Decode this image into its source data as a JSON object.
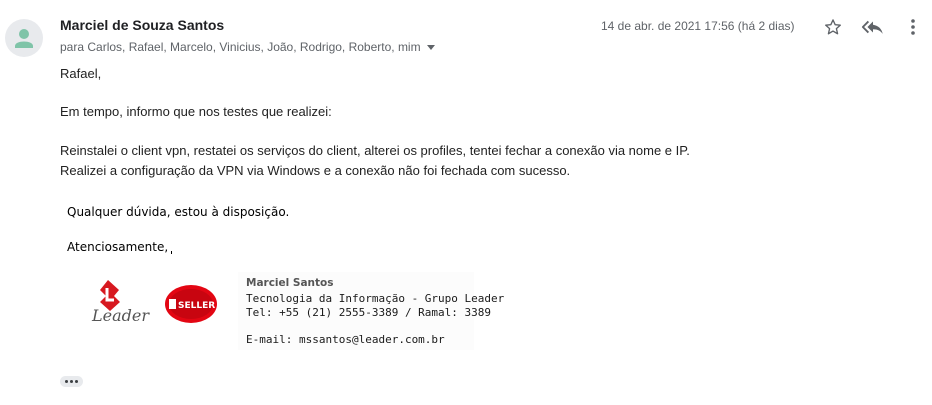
{
  "message": {
    "sender": "Marciel de Souza Santos",
    "recipients": "para Carlos, Rafael, Marcelo, Vinicius, João, Rodrigo, Roberto, mim",
    "date": "14 de abr. de 2021 17:56 (há 2 dias)"
  },
  "actions": {
    "star_icon": "star-outline-icon",
    "reply_icon": "reply-all-icon",
    "more_icon": "vertical-dots-icon"
  },
  "body": {
    "greeting": "Rafael,",
    "line1": "Em tempo, informo que nos testes que realizei:",
    "line2": "Reinstalei o client vpn, restatei os serviços do client, alterei os profiles, tentei fechar a conexão via nome e IP.",
    "line3": "Realizei a configuração da VPN via Windows e a conexão não foi fechada com sucesso.",
    "line4": "Qualquer dúvida, estou à disposição.",
    "line5": "Atenciosamente,"
  },
  "signature": {
    "logo1_text": "Leader",
    "logo2_text": "SELLER",
    "name": "Marciel Santos",
    "department": "Tecnologia da Informação - Grupo Leader",
    "phone": "Tel: +55 (21) 2555-3389 / Ramal: 3389",
    "email": "E-mail: mssantos@leader.com.br"
  },
  "colors": {
    "avatar_person": "#7fc4a8",
    "leader_red": "#d71920",
    "seller_red": "#e30613"
  }
}
